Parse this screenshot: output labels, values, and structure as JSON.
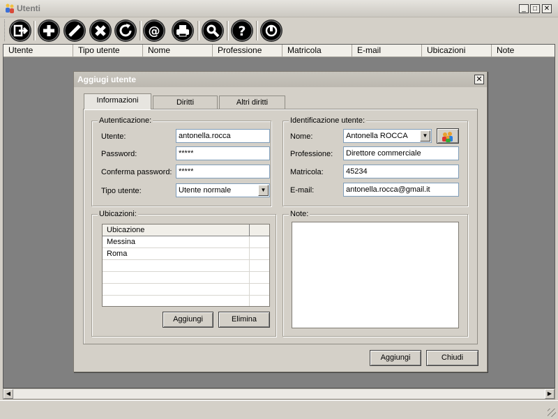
{
  "window": {
    "title": "Utenti"
  },
  "toolbar": {
    "icons": [
      "exit-icon",
      "add-icon",
      "edit-icon",
      "delete-icon",
      "refresh-icon",
      "email-icon",
      "print-icon",
      "search-icon",
      "help-icon",
      "power-icon"
    ]
  },
  "grid": {
    "columns": [
      "Utente",
      "Tipo utente",
      "Nome",
      "Professione",
      "Matricola",
      "E-mail",
      "Ubicazioni",
      "Note"
    ]
  },
  "dialog": {
    "title": "Aggiugi utente",
    "tabs": [
      "Informazioni",
      "Diritti",
      "Altri diritti"
    ],
    "auth": {
      "group_label": "Autenticazione:",
      "user_label": "Utente:",
      "user_value": "antonella.rocca",
      "password_label": "Password:",
      "password_value": "*****",
      "confirm_label": "Conferma password:",
      "confirm_value": "*****",
      "type_label": "Tipo utente:",
      "type_value": "Utente normale"
    },
    "ident": {
      "group_label": "Identificazione utente:",
      "name_label": "Nome:",
      "name_value": "Antonella ROCCA",
      "profession_label": "Professione:",
      "profession_value": "Direttore commerciale",
      "matricola_label": "Matricola:",
      "matricola_value": "45234",
      "email_label": "E-mail:",
      "email_value": "antonella.rocca@gmail.it"
    },
    "locations": {
      "group_label": "Ubicazioni:",
      "column": "Ubicazione",
      "rows": [
        "Messina",
        "Roma"
      ],
      "add_label": "Aggiungi",
      "delete_label": "Elimina"
    },
    "notes": {
      "group_label": "Note:",
      "value": ""
    },
    "footer": {
      "add_label": "Aggiungi",
      "close_label": "Chiudi"
    }
  },
  "colors": {
    "title_text": "#7a7a7a",
    "grid_background": "#808080",
    "chrome": "#d4d0c8"
  }
}
